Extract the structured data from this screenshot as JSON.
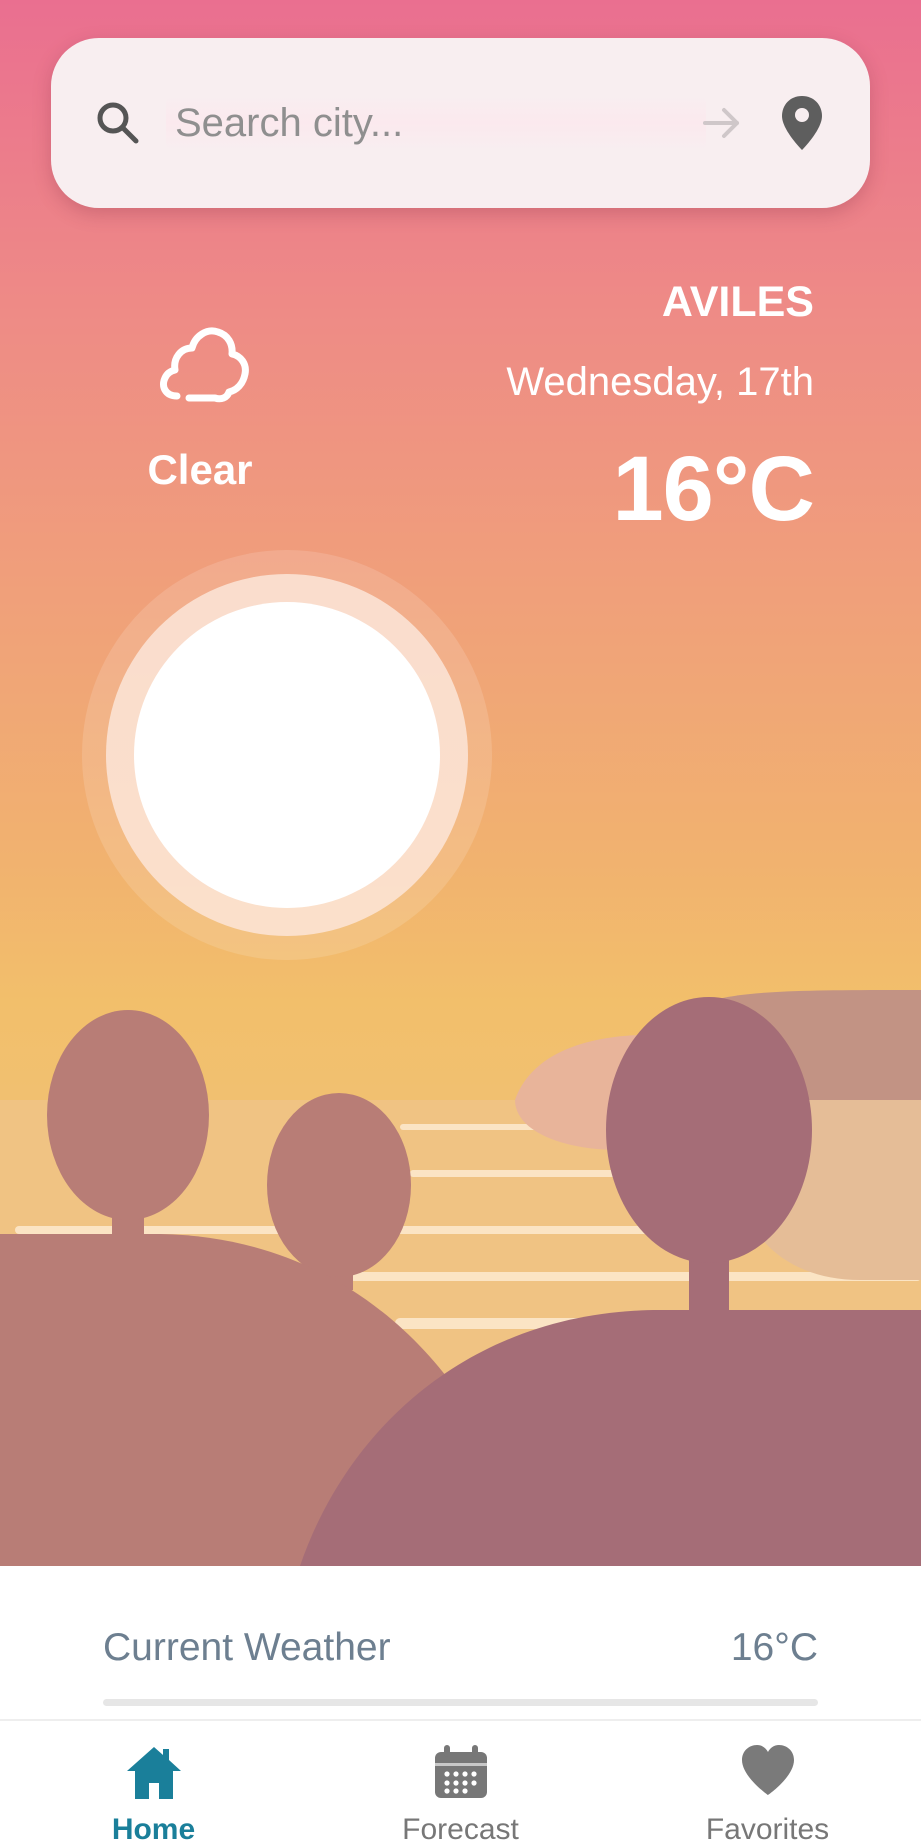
{
  "search": {
    "placeholder": "Search city..."
  },
  "weather": {
    "condition": "Clear",
    "city": "AVILES",
    "date": "Wednesday, 17th",
    "temperature": "16°C"
  },
  "current_weather": {
    "label": "Current Weather",
    "value": "16°C"
  },
  "nav": {
    "items": [
      {
        "label": "Home",
        "icon": "home-icon",
        "active": true
      },
      {
        "label": "Forecast",
        "icon": "calendar-icon",
        "active": false
      },
      {
        "label": "Favorites",
        "icon": "heart-icon",
        "active": false
      }
    ]
  },
  "colors": {
    "accent": "#1a7f9a",
    "sky_top": "#ea6f90",
    "sky_bottom": "#f2bf6b",
    "hill_left": "#b87d76",
    "hill_right": "#a56d77"
  }
}
